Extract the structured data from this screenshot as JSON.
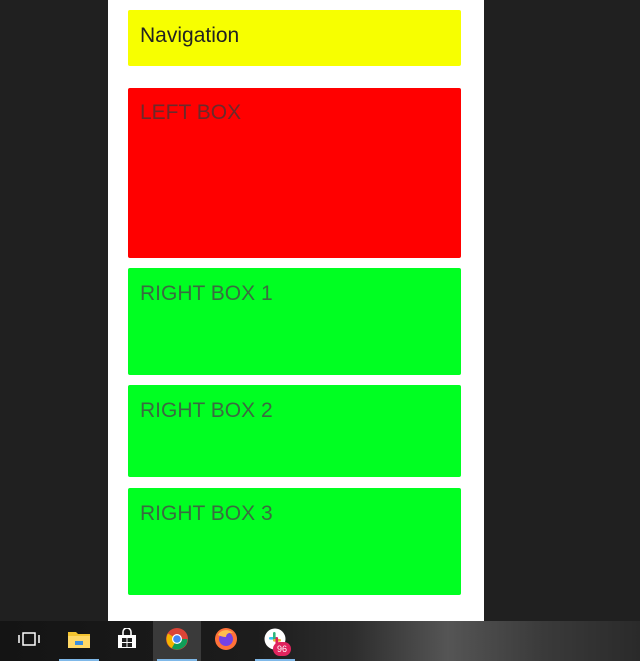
{
  "page": {
    "nav_label": "Navigation",
    "left_box_label": "LEFT BOX",
    "right_boxes": [
      {
        "label": "RIGHT BOX 1"
      },
      {
        "label": "RIGHT BOX 2"
      },
      {
        "label": "RIGHT BOX 3"
      }
    ]
  },
  "colors": {
    "nav": "#f7ff00",
    "left_box": "#ff0000",
    "right_box": "#00ff22"
  },
  "taskbar": {
    "items": [
      {
        "icon": "task-view-icon"
      },
      {
        "icon": "file-explorer-icon"
      },
      {
        "icon": "microsoft-store-icon"
      },
      {
        "icon": "chrome-icon"
      },
      {
        "icon": "firefox-icon"
      },
      {
        "icon": "slack-icon",
        "badge": "96"
      }
    ]
  }
}
